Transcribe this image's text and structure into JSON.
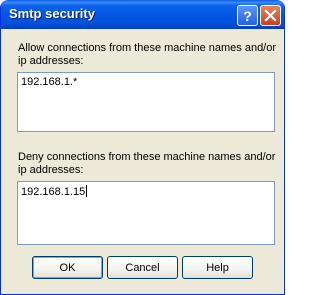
{
  "window": {
    "title": "Smtp security"
  },
  "titlebar": {
    "help_glyph": "?",
    "help_icon": "question-mark-icon",
    "close_icon": "close-x-icon"
  },
  "allow": {
    "label": "Allow connections from these machine names and/or ip addresses:",
    "value": "192.168.1.*"
  },
  "deny": {
    "label": "Deny connections from these machine names and/or ip addresses:",
    "value": "192.168.1.15"
  },
  "buttons": {
    "ok": "OK",
    "cancel": "Cancel",
    "help": "Help"
  },
  "colors": {
    "titlebar_blue": "#0355e0",
    "close_red": "#c8401f",
    "dialog_face": "#ece9d8",
    "textbox_border": "#7f9db9"
  }
}
